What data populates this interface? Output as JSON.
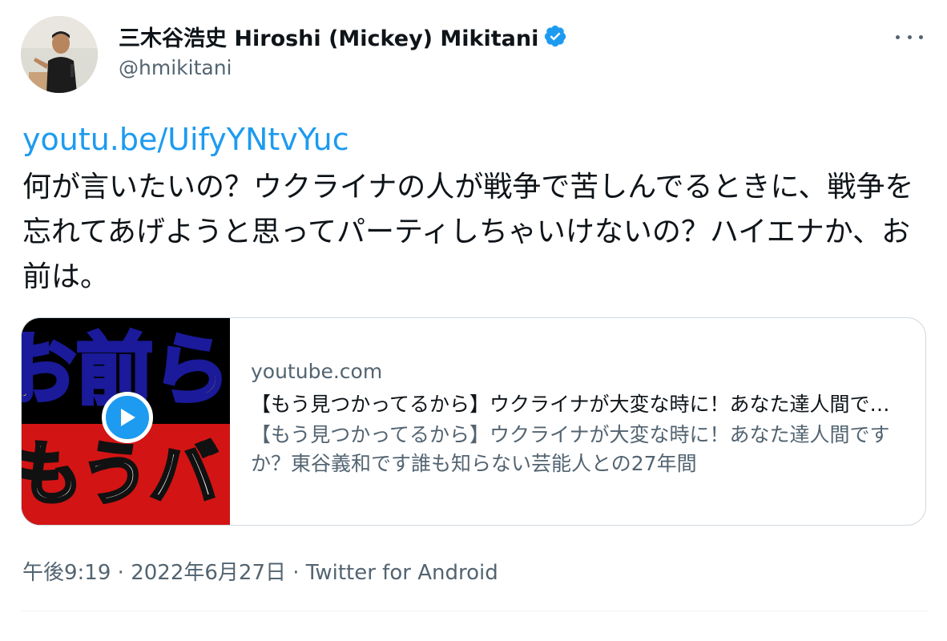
{
  "author": {
    "display_name": "三木谷浩史 Hiroshi (Mickey) Mikitani",
    "handle": "@hmikitani",
    "verified": true
  },
  "tweet": {
    "link": "youtu.be/UifyYNtvYuc",
    "text": "何が言いたいの？ウクライナの人が戦争で苦しんでるときに、戦争を忘れてあげようと思ってパーティしちゃいけないの？ハイエナか、お前は。"
  },
  "card": {
    "thumbnail_text_top": "お前ら",
    "thumbnail_text_bottom": "もうバレてる",
    "domain": "youtube.com",
    "title": "【もう見つかってるから】ウクライナが大変な時に！あなた達人間ですか？東谷義和です誰も知らない芸能人との27年間",
    "description": "【もう見つかってるから】ウクライナが大変な時に！あなた達人間ですか？東谷義和です誰も知らない芸能人との27年間"
  },
  "meta": {
    "time": "午後9:19",
    "date": "2022年6月27日",
    "source": "Twitter for Android",
    "separator": "·"
  },
  "colors": {
    "link": "#1d9bf0",
    "secondary_text": "#536471",
    "primary_text": "#0f1419",
    "verified_badge": "#1d9bf0"
  },
  "icons": {
    "verified": "verified-badge-icon",
    "more": "more-horizontal-icon",
    "play": "play-icon"
  }
}
